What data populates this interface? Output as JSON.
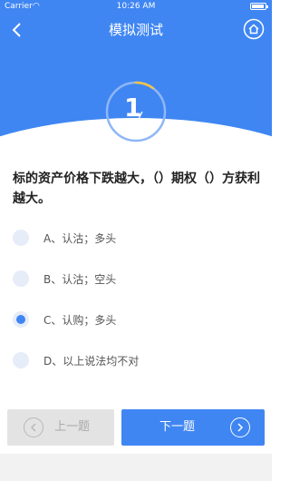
{
  "status_bar": {
    "carrier": "Carrier",
    "time": "10:26 AM"
  },
  "header": {
    "title": "模拟测试",
    "back_icon": "chevron-left-icon",
    "home_icon": "home-icon"
  },
  "progress": {
    "current": "1",
    "total": "10",
    "fraction": 0.1
  },
  "question": {
    "text": "标的资产价格下跌越大，（）期权（）方获利越大。"
  },
  "options": [
    {
      "label": "A、认沽；多头",
      "selected": false
    },
    {
      "label": "B、认沽；空头",
      "selected": false
    },
    {
      "label": "C、认购；多头",
      "selected": true
    },
    {
      "label": "D、以上说法均不对",
      "selected": false
    }
  ],
  "footer": {
    "prev_label": "上一题",
    "next_label": "下一题"
  },
  "colors": {
    "accent": "#3f86f3",
    "progress_arc": "#f5c542",
    "disabled": "#e3e3e3"
  }
}
